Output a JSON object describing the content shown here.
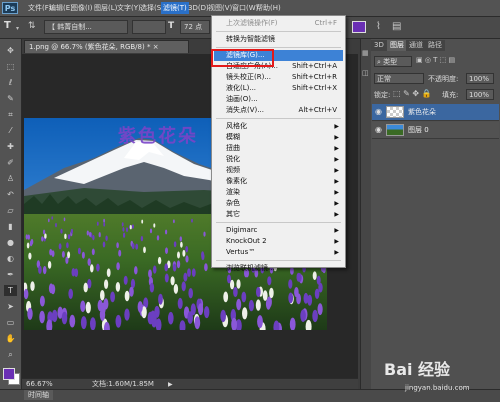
{
  "app": {
    "logo": "Ps"
  },
  "menubar": {
    "items": [
      "文件(F)",
      "编辑(E)",
      "图像(I)",
      "图层(L)",
      "文字(Y)",
      "选择(S)",
      "滤镜(T)",
      "3D(D)",
      "视图(V)",
      "窗口(W)",
      "帮助(H)"
    ],
    "active_index": 6
  },
  "options": {
    "tool_glyph": "T",
    "font_family": "【 韩菁自制...",
    "font_size": "72 点",
    "color_swatch": "#6a2fb4"
  },
  "document": {
    "tab_label": "1.png @ 66.7% (紫色花朵, RGB/8) *",
    "title_text": "紫色花朵",
    "zoom": "66.67%",
    "doc_info": "文档:1.60M/1.85M"
  },
  "timeline": {
    "label": "时间轴"
  },
  "panel": {
    "tabs": [
      "3D",
      "图层",
      "通道",
      "路径"
    ],
    "active_tab": 1,
    "filter_kind": "类型",
    "blend_mode": "正常",
    "opacity_label": "不透明度:",
    "opacity_value": "100%",
    "lock_label": "锁定:",
    "fill_label": "填充:",
    "fill_value": "100%",
    "layers": [
      {
        "name": "紫色花朵",
        "selected": true
      },
      {
        "name": "图层 0",
        "selected": false
      }
    ]
  },
  "filter_menu": {
    "items": [
      {
        "label": "上次滤镜操作(F)",
        "shortcut": "Ctrl+F",
        "disabled": true
      },
      {
        "sep": true
      },
      {
        "label": "转换为智能滤镜"
      },
      {
        "sep": true
      },
      {
        "label": "滤镜库(G)...",
        "highlight": true
      },
      {
        "label": "自适应广角(A)...",
        "shortcut": "Shift+Ctrl+A"
      },
      {
        "label": "镜头校正(R)...",
        "shortcut": "Shift+Ctrl+R"
      },
      {
        "label": "液化(L)...",
        "shortcut": "Shift+Ctrl+X"
      },
      {
        "label": "油画(O)..."
      },
      {
        "label": "消失点(V)...",
        "shortcut": "Alt+Ctrl+V"
      },
      {
        "sep": true
      },
      {
        "label": "风格化",
        "submenu": true
      },
      {
        "label": "模糊",
        "submenu": true
      },
      {
        "label": "扭曲",
        "submenu": true
      },
      {
        "label": "锐化",
        "submenu": true
      },
      {
        "label": "视频",
        "submenu": true
      },
      {
        "label": "像素化",
        "submenu": true
      },
      {
        "label": "渲染",
        "submenu": true
      },
      {
        "label": "杂色",
        "submenu": true
      },
      {
        "label": "其它",
        "submenu": true
      },
      {
        "sep": true
      },
      {
        "label": "Digimarc",
        "submenu": true
      },
      {
        "label": "KnockOut 2",
        "submenu": true
      },
      {
        "label": "Vertus™",
        "submenu": true
      },
      {
        "sep": true
      },
      {
        "label": "浏览联机滤镜..."
      }
    ]
  },
  "watermark": {
    "brand": "Bai 经验",
    "url": "jingyan.baidu.com"
  }
}
